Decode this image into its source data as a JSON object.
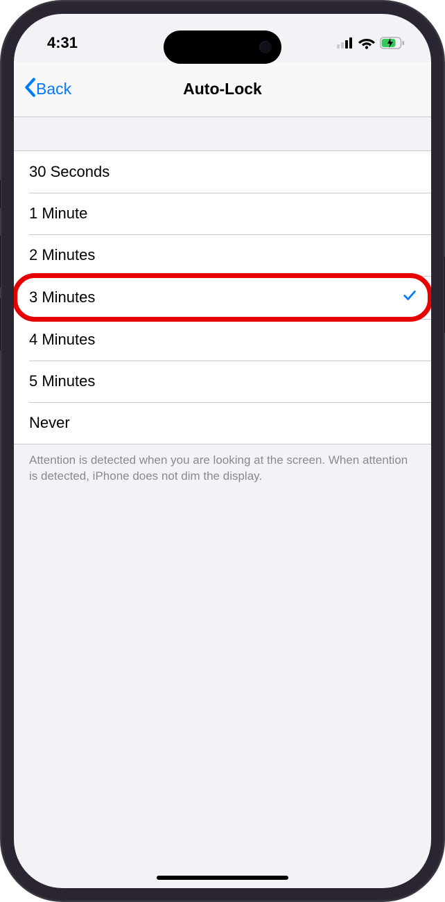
{
  "status_bar": {
    "time": "4:31"
  },
  "nav": {
    "back_label": "Back",
    "title": "Auto-Lock"
  },
  "options": [
    {
      "label": "30 Seconds",
      "selected": false
    },
    {
      "label": "1 Minute",
      "selected": false
    },
    {
      "label": "2 Minutes",
      "selected": false
    },
    {
      "label": "3 Minutes",
      "selected": true
    },
    {
      "label": "4 Minutes",
      "selected": false
    },
    {
      "label": "5 Minutes",
      "selected": false
    },
    {
      "label": "Never",
      "selected": false
    }
  ],
  "footer": "Attention is detected when you are looking at the screen. When attention is detected, iPhone does not dim the display.",
  "highlight_index": 3,
  "colors": {
    "tint": "#007aff",
    "annotation": "#e60000"
  }
}
